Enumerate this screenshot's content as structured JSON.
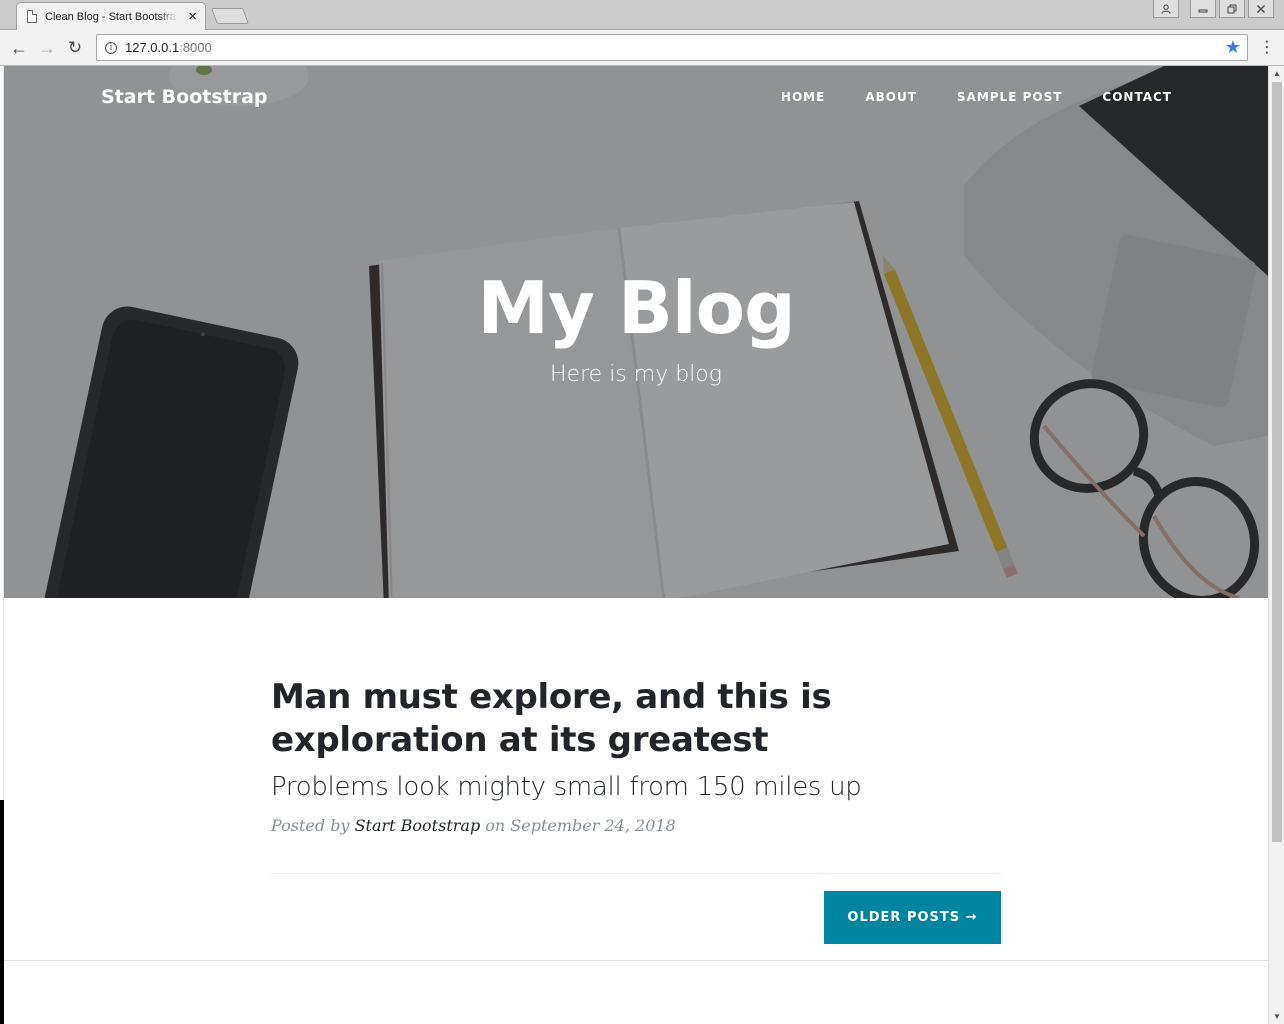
{
  "browser": {
    "tab_title": "Clean Blog - Start Bootstrap",
    "tab_close": "×",
    "url_host": "127.0.0.1",
    "url_port": ":8000",
    "info_glyph": "i",
    "star_glyph": "★",
    "menu_glyph": "⋮",
    "back_glyph": "←",
    "forward_glyph": "→",
    "reload_glyph": "↻",
    "minimize_glyph": "▭",
    "restore_glyph": "❐",
    "close_glyph": "✕",
    "user_glyph": "👤"
  },
  "site": {
    "brand": "Start Bootstrap",
    "nav": [
      {
        "label": "Home"
      },
      {
        "label": "About"
      },
      {
        "label": "Sample Post"
      },
      {
        "label": "Contact"
      }
    ]
  },
  "hero": {
    "title": "My Blog",
    "subtitle": "Here is my blog"
  },
  "post": {
    "title": "Man must explore, and this is exploration at its greatest",
    "subtitle": "Problems look mighty small from 150 miles up",
    "meta_prefix": "Posted by ",
    "author": "Start Bootstrap",
    "meta_on": " on ",
    "date": "September 24, 2018"
  },
  "pager": {
    "older_label": "Older Posts →"
  },
  "colors": {
    "accent": "#0085a1",
    "text_dark": "#212529",
    "meta_gray": "#868e96",
    "star_blue": "#3b7be8"
  }
}
